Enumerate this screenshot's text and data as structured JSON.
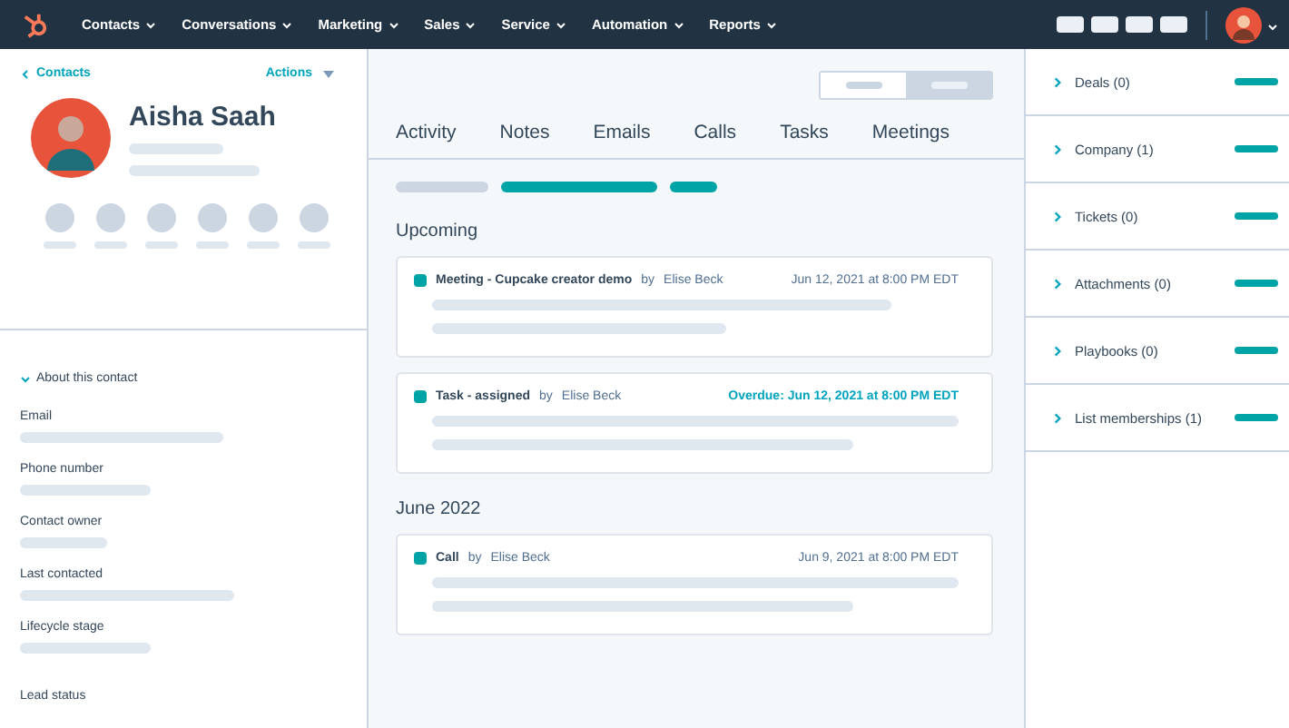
{
  "nav": {
    "items": [
      "Contacts",
      "Conversations",
      "Marketing",
      "Sales",
      "Service",
      "Automation",
      "Reports"
    ]
  },
  "contact": {
    "back_link": "Contacts",
    "actions": "Actions",
    "name": "Aisha Saah",
    "about_title": "About this contact",
    "expanded": true,
    "fields": [
      "Email",
      "Phone number",
      "Contact owner",
      "Last contacted",
      "Lifecycle stage",
      "Lead status"
    ]
  },
  "view_toggle": [
    {
      "selected": false
    },
    {
      "selected": true
    }
  ],
  "tabs": [
    "Activity",
    "Notes",
    "Emails",
    "Calls",
    "Tasks",
    "Meetings"
  ],
  "sections": [
    {
      "heading": "Upcoming",
      "entries": [
        {
          "title": "Meeting - Cupcake creator demo",
          "by": "by",
          "author": "Elise Beck",
          "date": "Jun 12, 2021 at 8:00 PM EDT",
          "overdue": false
        },
        {
          "title": "Task - assigned",
          "by": "by",
          "author": "Elise Beck",
          "date": "Overdue: Jun 12, 2021 at 8:00 PM EDT",
          "overdue": true
        }
      ]
    },
    {
      "heading": "June 2022",
      "entries": [
        {
          "title": "Call",
          "by": "by",
          "author": "Elise Beck",
          "date": "Jun 9, 2021 at 8:00 PM EDT",
          "overdue": false
        }
      ]
    }
  ],
  "sidebar": {
    "items": [
      {
        "label": "Deals (0)"
      },
      {
        "label": "Company (1)"
      },
      {
        "label": "Tickets (0)"
      },
      {
        "label": "Attachments (0)"
      },
      {
        "label": "Playbooks (0)"
      },
      {
        "label": "List memberships (1)"
      }
    ]
  }
}
